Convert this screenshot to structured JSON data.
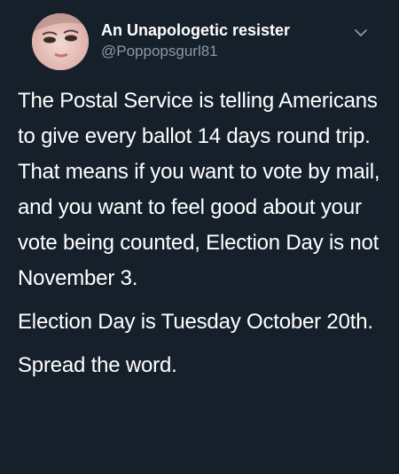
{
  "author": {
    "display_name": "An Unapologetic resister",
    "handle": "@Poppopsgurl81",
    "avatar_icon": "profile-photo"
  },
  "menu": {
    "icon": "chevron-down-icon"
  },
  "tweet": {
    "paragraphs": [
      "The Postal Service is telling Americans to give every ballot 14 days round trip. That means if you want to vote by mail, and you want to feel good about your vote being counted, Election Day is not November 3.",
      "Election Day is Tuesday October 20th.",
      "Spread the word."
    ]
  },
  "colors": {
    "background": "#15202b",
    "text": "#ffffff",
    "secondary_text": "#8899a6"
  }
}
